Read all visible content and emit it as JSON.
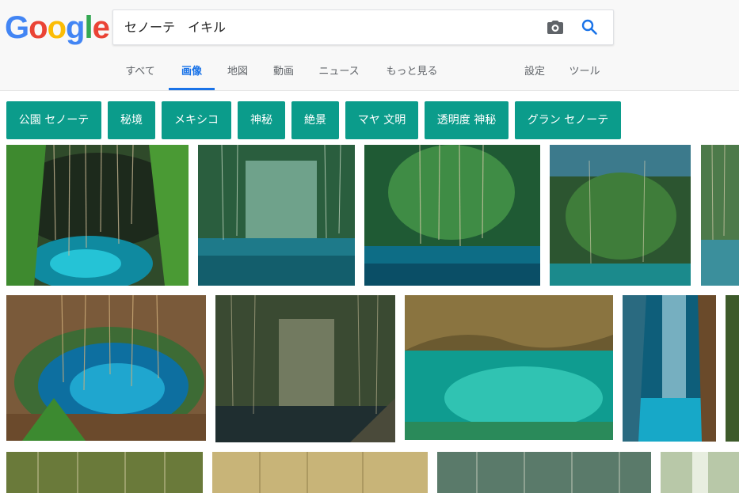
{
  "logo": {
    "letters": [
      "G",
      "o",
      "o",
      "g",
      "l",
      "e"
    ],
    "colors": [
      "#4285F4",
      "#EA4335",
      "#FBBC05",
      "#4285F4",
      "#34A853",
      "#EA4335"
    ]
  },
  "search": {
    "value": "セノーテ　イキル",
    "camera_icon": "camera-icon",
    "search_icon": "magnifier-icon",
    "accent": "#1a73e8"
  },
  "tabs": [
    {
      "label": "すべて"
    },
    {
      "label": "画像",
      "active": true
    },
    {
      "label": "地図"
    },
    {
      "label": "動画"
    },
    {
      "label": "ニュース"
    },
    {
      "label": "もっと見る"
    },
    {
      "label": "設定"
    },
    {
      "label": "ツール"
    }
  ],
  "chips": [
    {
      "label": "公園 セノーテ"
    },
    {
      "label": "秘境"
    },
    {
      "label": "メキシコ"
    },
    {
      "label": "神秘"
    },
    {
      "label": "絶景"
    },
    {
      "label": "マヤ 文明"
    },
    {
      "label": "透明度 神秘"
    },
    {
      "label": "グラン セノーテ"
    }
  ],
  "chip_color": "#0b9c8b",
  "images": [
    {
      "scene": "cenote-ik-kil-vines-overhead"
    },
    {
      "scene": "cenote-waterfall-sunlit"
    },
    {
      "scene": "cenote-hanging-roots-green"
    },
    {
      "scene": "cenote-jungle-wall"
    },
    {
      "scene": "cenote-partial"
    },
    {
      "scene": "cenote-ik-kil-aerial-round"
    },
    {
      "scene": "cenote-vines-dark-steps"
    },
    {
      "scene": "cenote-cave-turquoise"
    },
    {
      "scene": "cenote-sunbeam-swimmer"
    },
    {
      "scene": "cenote-partial-edge"
    },
    {
      "scene": "cenote-row3-a"
    },
    {
      "scene": "cenote-row3-b"
    },
    {
      "scene": "cenote-row3-c"
    },
    {
      "scene": "cenote-row3-d"
    }
  ]
}
